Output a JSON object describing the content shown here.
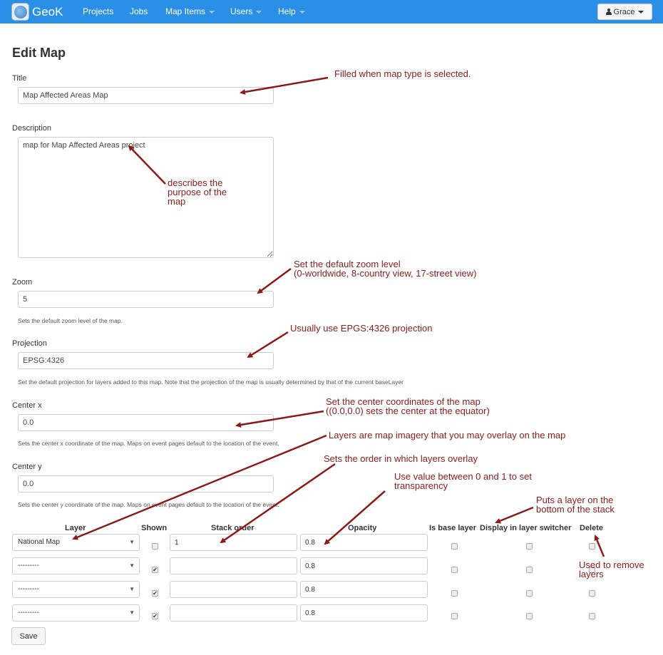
{
  "navbar": {
    "brand": "GeoK",
    "links": {
      "projects": "Projects",
      "jobs": "Jobs",
      "map_items": "Map Items",
      "users": "Users",
      "help": "Help"
    },
    "user": "Grace"
  },
  "page_title": "Edit Map",
  "fields": {
    "title": {
      "label": "Title",
      "value": "Map Affected Areas Map"
    },
    "description": {
      "label": "Description",
      "value": "map for Map Affected Areas project"
    },
    "zoom": {
      "label": "Zoom",
      "value": "5",
      "help": "Sets the default zoom level of the map."
    },
    "projection": {
      "label": "Projection",
      "value": "EPSG:4326",
      "help": "Set the default projection for layers added to this map. Note that the projection of the map is usually determined by that of the current baseLayer"
    },
    "center_x": {
      "label": "Center x",
      "value": "0.0",
      "help": "Sets the center x coordinate of the map. Maps on event pages default to the location of the event."
    },
    "center_y": {
      "label": "Center y",
      "value": "0.0",
      "help": "Sets the center y coordinate of the map. Maps on event pages default to the location of the event."
    }
  },
  "layers_table": {
    "headers": {
      "layer": "Layer",
      "shown": "Shown",
      "stack_order": "Stack order",
      "opacity": "Opacity",
      "is_base": "Is base layer",
      "display": "Display in layer switcher",
      "delete": "Delete"
    },
    "rows": [
      {
        "layer": "National Map",
        "shown": false,
        "stack_order": "1",
        "opacity": "0.8"
      },
      {
        "layer": "---------",
        "shown": true,
        "stack_order": "",
        "opacity": "0.8"
      },
      {
        "layer": "---------",
        "shown": true,
        "stack_order": "",
        "opacity": "0.8"
      },
      {
        "layer": "---------",
        "shown": true,
        "stack_order": "",
        "opacity": "0.8"
      }
    ]
  },
  "save_label": "Save",
  "annotations": {
    "title": "Filled when map type is selected.",
    "description": "describes the\npurpose of the\nmap",
    "zoom": "Set the default zoom level\n(0-worldwide, 8-country view, 17-street view)",
    "projection": "Usually use EPGS:4326 projection",
    "center": "Set the center coordinates of the map\n((0.0,0.0) sets the center at the equator)",
    "layers": "Layers are map imagery that you may overlay on the map",
    "stack": "Sets the order in which layers overlay",
    "opacity": "Use value between 0 and 1 to set\ntransparency",
    "bottom": "Puts a layer on the\nbottom of the stack",
    "delete": "Used to remove\nlayers"
  },
  "colors": {
    "navbar": "#2a8fe6",
    "annotation": "#8b1a1a"
  },
  "icons": [
    "globe-logo-icon",
    "user-icon",
    "caret-down-icon",
    "select-arrow-icon",
    "checkbox-icon"
  ]
}
